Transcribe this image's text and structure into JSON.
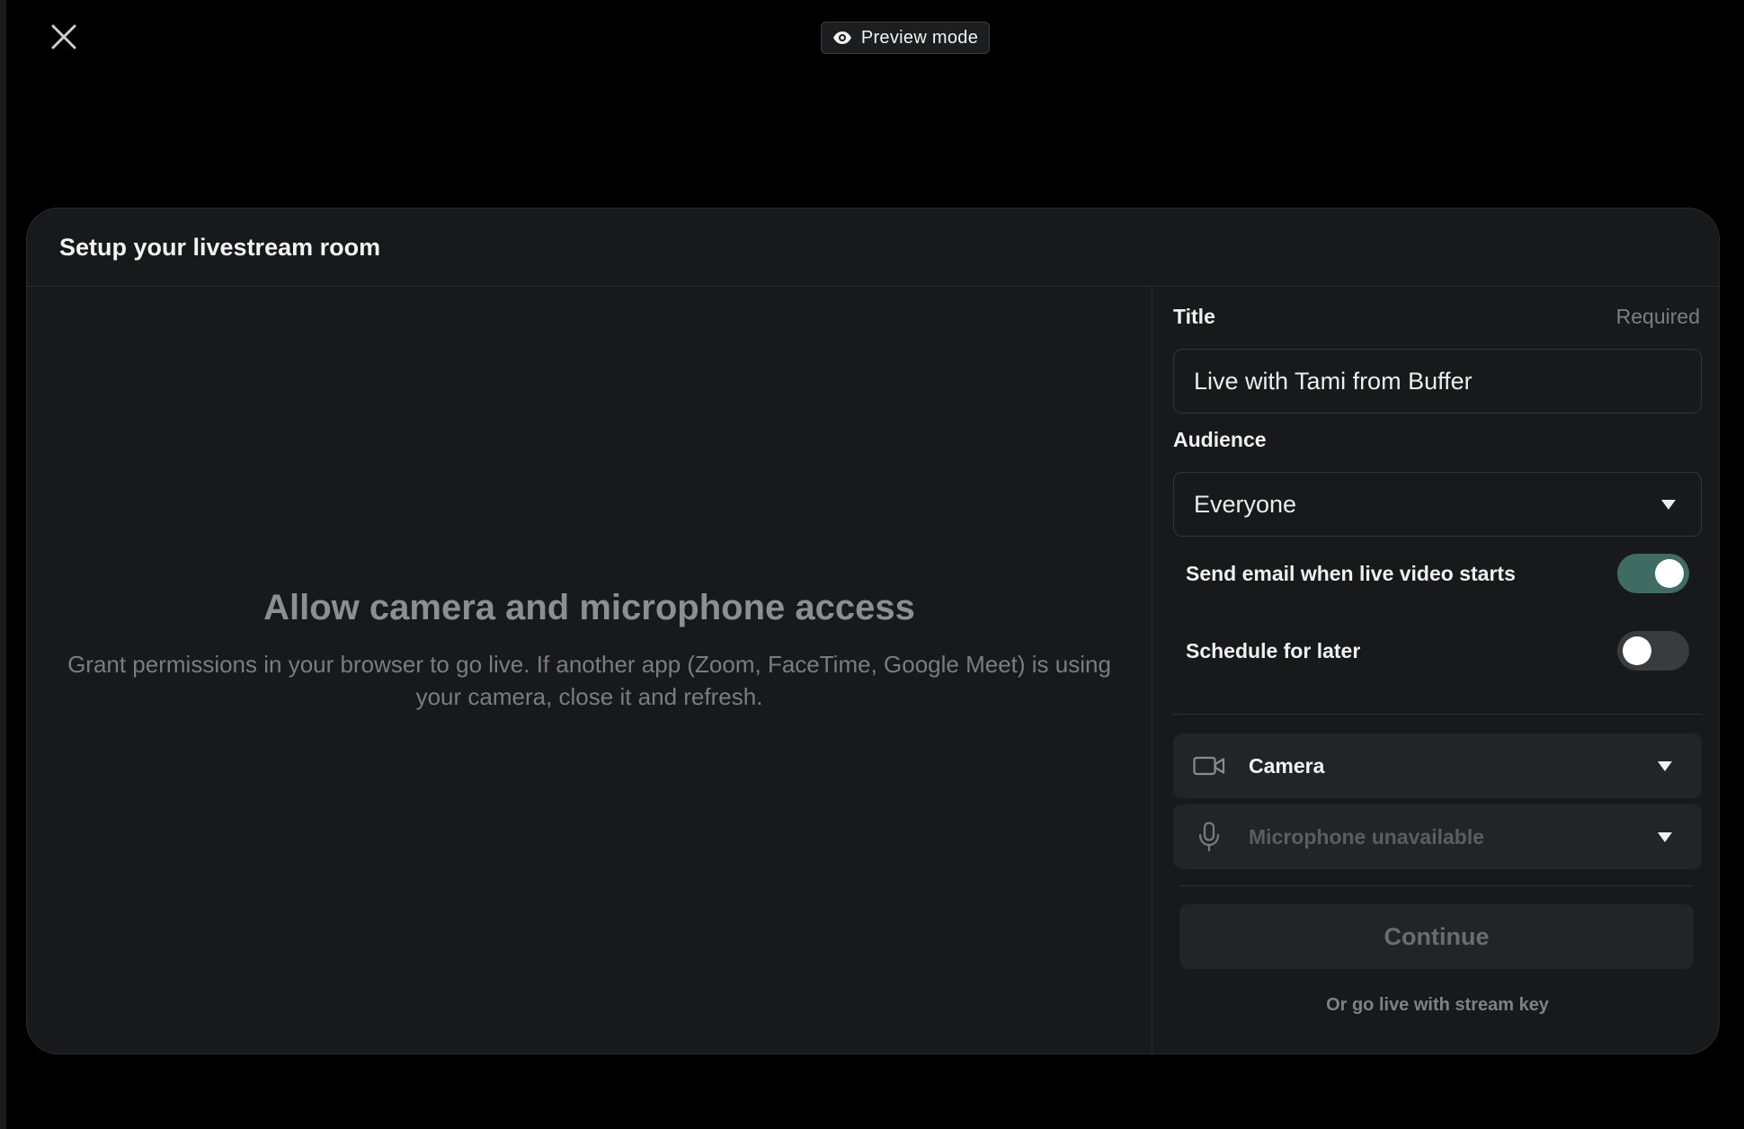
{
  "top_bar": {
    "preview_badge": "Preview mode"
  },
  "modal": {
    "title": "Setup your livestream room",
    "permission": {
      "title": "Allow camera and microphone access",
      "description": "Grant permissions in your browser to go live. If another app (Zoom, FaceTime, Google Meet) is using your camera, close it and refresh."
    },
    "form": {
      "title_label": "Title",
      "title_hint": "Required",
      "title_value": "Live with Tami from Buffer",
      "audience_label": "Audience",
      "audience_value": "Everyone",
      "email_toggle_label": "Send email when live video starts",
      "email_toggle_on": true,
      "schedule_toggle_label": "Schedule for later",
      "schedule_toggle_on": false,
      "camera_label": "Camera",
      "microphone_label": "Microphone unavailable",
      "continue_label": "Continue",
      "stream_key_link": "Or go live with stream key"
    }
  },
  "colors": {
    "background": "#000000",
    "modal_bg": "#18191b",
    "toggle_on": "#3f6b63",
    "toggle_off": "#3a3b3e"
  },
  "icons": {
    "close": "close-icon",
    "preview": "eye-icon",
    "camera": "video-camera-icon",
    "microphone": "microphone-icon"
  }
}
